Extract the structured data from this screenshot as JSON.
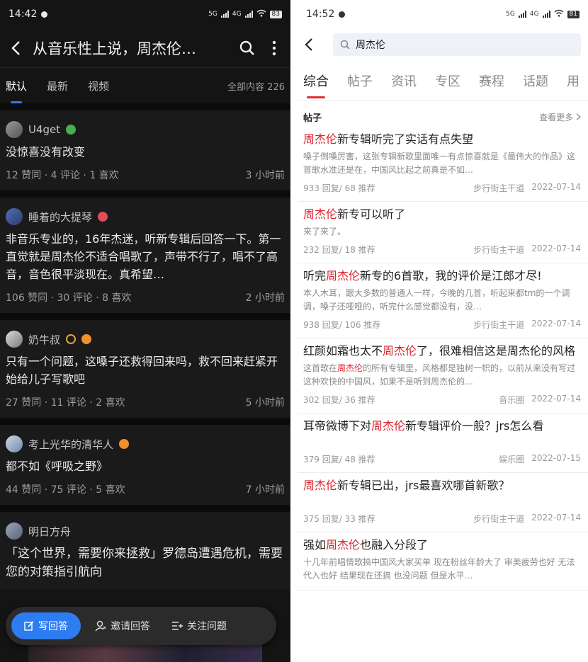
{
  "left": {
    "status": {
      "time": "14:42",
      "net1": "5G",
      "net2": "4G",
      "battery": "83"
    },
    "header": {
      "title": "从音乐性上说，周杰伦…"
    },
    "tabs": [
      "默认",
      "最新",
      "视频"
    ],
    "total_label": "全部内容 226",
    "posts": [
      {
        "user": "U4get",
        "text": "没惊喜没有改变",
        "stats": "12 赞同 · 4 评论 · 1 喜欢",
        "time": "3 小时前"
      },
      {
        "user": "睡着的大提琴",
        "text": "非音乐专业的，16年杰迷，听新专辑后回答一下。第一直觉就是周杰伦不适合唱歌了，声带不行了，唱不了高音，音色很平淡现在。真希望…",
        "stats": "106 赞同 · 30 评论 · 8 喜欢",
        "time": "2 小时前"
      },
      {
        "user": "奶牛叔",
        "text": "只有一个问题，这嗓子还救得回来吗，救不回来赶紧开始给儿子写歌吧",
        "stats": "27 赞同 · 11 评论 · 2 喜欢",
        "time": "5 小时前"
      },
      {
        "user": "考上光华的清华人",
        "text": "都不如《呼吸之野》",
        "stats": "44 赞同 · 75 评论 · 5 喜欢",
        "time": "7 小时前"
      },
      {
        "user": "明日方舟",
        "text": "「这个世界，需要你来拯救」罗德岛遭遇危机，需要您的对策指引航向",
        "stats": "",
        "time": ""
      }
    ],
    "actions": {
      "write": "写回答",
      "invite": "邀请回答",
      "follow": "关注问题"
    }
  },
  "right": {
    "status": {
      "time": "14:52",
      "net1": "5G",
      "net2": "4G",
      "battery": "81"
    },
    "search": {
      "query": "周杰伦"
    },
    "tabs": [
      "综合",
      "帖子",
      "资讯",
      "专区",
      "赛程",
      "话题",
      "用"
    ],
    "section": {
      "title": "帖子",
      "more": "查看更多"
    },
    "results": [
      {
        "t1": "",
        "hl": "周杰伦",
        "t2": "新专辑听完了实话有点失望",
        "s1": "嗓子倒嗓厉害，这张专辑新歌里面唯一有点惊喜就是《最伟大的作品》这首歌水准还是在，中国风比起之前真是不如…",
        "shl": "",
        "s2": "",
        "stats": "933 回复/ 68 推荐",
        "src": "步行街主干道",
        "date": "2022-07-14"
      },
      {
        "t1": "",
        "hl": "周杰伦",
        "t2": "新专可以听了",
        "s1": "来了来了。",
        "shl": "",
        "s2": "",
        "stats": "232 回复/ 18 推荐",
        "src": "步行街主干道",
        "date": "2022-07-14"
      },
      {
        "t1": "听完",
        "hl": "周杰伦",
        "t2": "新专的6首歌，我的评价是江郎才尽!",
        "s1": "本人木耳，跟大多数的普通人一样，今晚的几首，听起来都tm的一个调调，嗓子还哑哑的，听完什么感觉都没有，没…",
        "shl": "",
        "s2": "",
        "stats": "938 回复/ 106 推荐",
        "src": "步行街主干道",
        "date": "2022-07-14"
      },
      {
        "t1": "红颜如霜也太不",
        "hl": "周杰伦",
        "t2": "了，很难相信这是周杰伦的风格",
        "s1": "这首歌在",
        "shl": "周杰伦",
        "s2": "的所有专辑里，风格都是独树一帜的，以前从来没有写过这种欢快的中国风，如果不是听到周杰伦的…",
        "stats": "302 回复/ 36 推荐",
        "src": "音乐圈",
        "date": "2022-07-14"
      },
      {
        "t1": "耳帝微博下对",
        "hl": "周杰伦",
        "t2": "新专辑评价一般？jrs怎么看",
        "s1": "",
        "shl": "",
        "s2": "",
        "stats": "379 回复/ 48 推荐",
        "src": "娱乐圈",
        "date": "2022-07-15"
      },
      {
        "t1": "",
        "hl": "周杰伦",
        "t2": "新专辑已出，jrs最喜欢哪首新歌？",
        "s1": "",
        "shl": "",
        "s2": "",
        "stats": "375 回复/ 33 推荐",
        "src": "步行街主干道",
        "date": "2022-07-14"
      },
      {
        "t1": "强如",
        "hl": "周杰伦",
        "t2": "也融入分段了",
        "s1": "十几年前唱情歌搞中国风大家买单 现在粉丝年龄大了 审美疲劳也好 无法代入也好 结果现在还搞 也没问题 但是水平…",
        "shl": "",
        "s2": "",
        "stats": "",
        "src": "",
        "date": ""
      }
    ]
  }
}
